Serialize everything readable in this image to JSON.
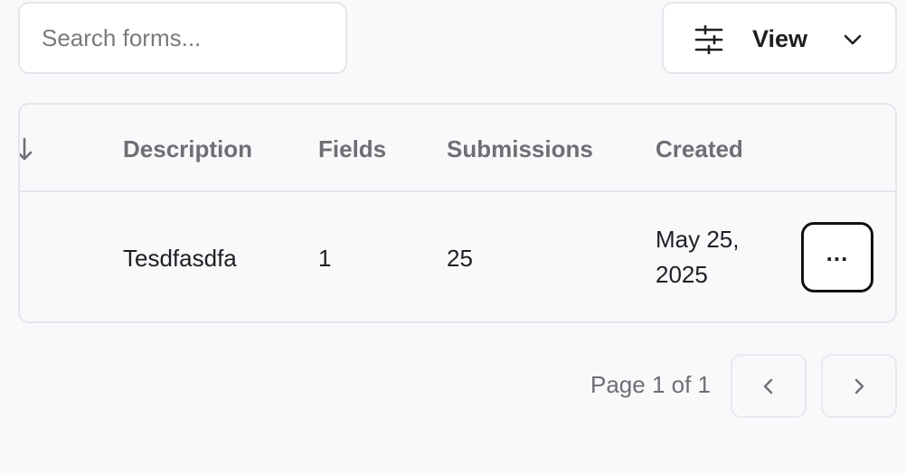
{
  "search": {
    "placeholder": "Search forms..."
  },
  "toolbar": {
    "view_label": "View",
    "view_icon": "sliders-icon",
    "dropdown_icon": "chevron-down-icon"
  },
  "table": {
    "sort_icon": "sort-arrow-icon",
    "headers": {
      "description": "Description",
      "fields": "Fields",
      "submissions": "Submissions",
      "created": "Created"
    },
    "rows": [
      {
        "description": "Tesdfasdfa",
        "fields": "1",
        "submissions": "25",
        "created_line1": "May 25,",
        "created_line2": "2025",
        "actions_label": "..."
      }
    ]
  },
  "pagination": {
    "label": "Page 1 of 1",
    "prev_icon": "chevron-left-icon",
    "next_icon": "chevron-right-icon"
  }
}
